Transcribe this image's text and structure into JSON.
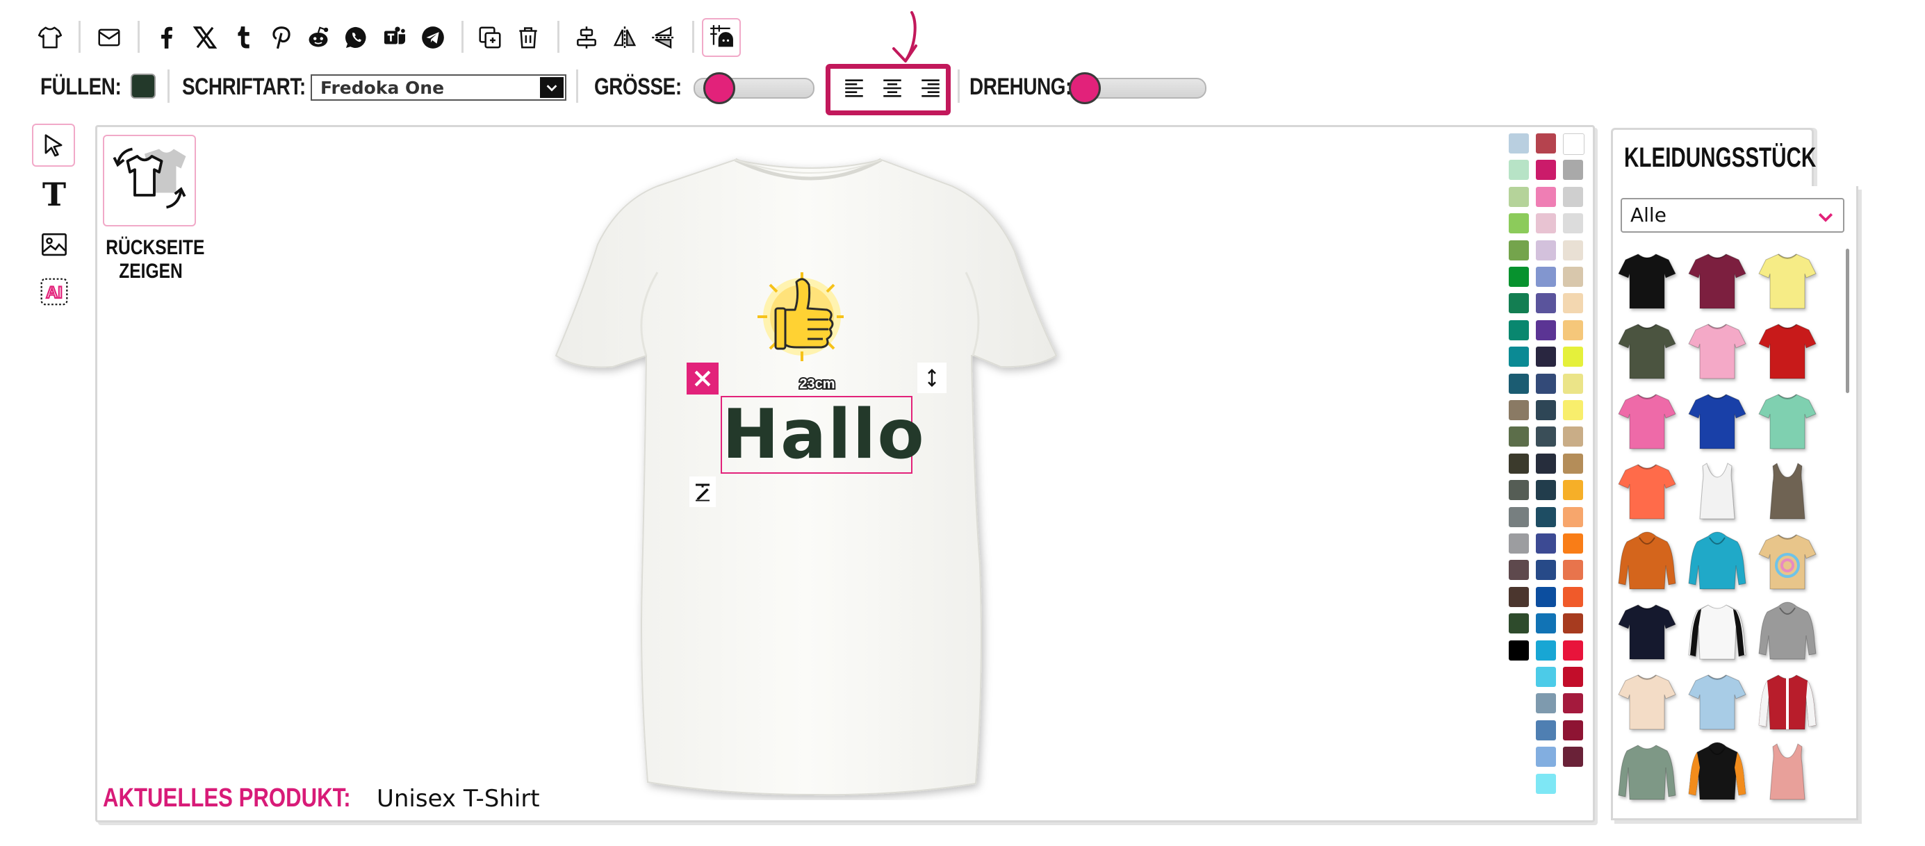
{
  "toolbar": {
    "fill_label": "FÜLLEN:",
    "fill_color": "#23392a",
    "font_label": "SCHRIFTART:",
    "font_value": "Fredoka One",
    "size_label": "GRÖSSE:",
    "size_level": 0.1,
    "rotation_label": "DREHUNG:",
    "rotation_level": 0.0,
    "top_icons": [
      "shirt-icon",
      "mail-icon",
      "facebook-icon",
      "x-icon",
      "tumblr-icon",
      "pinterest-icon",
      "reddit-icon",
      "whatsapp-icon",
      "teams-icon",
      "telegram-icon",
      "duplicate-icon",
      "trash-icon",
      "align-center-vertical-icon",
      "flip-horizontal-icon",
      "flip-vertical-icon",
      "grid-snap-icon"
    ],
    "align_icons": [
      "align-left-icon",
      "align-center-icon",
      "align-right-icon"
    ]
  },
  "left_tools": [
    "select-cursor-icon",
    "text-tool-icon",
    "image-tool-icon",
    "ai-tool-icon"
  ],
  "canvas": {
    "show_back_label_line1": "RÜCKSEITE",
    "show_back_label_line2": "ZEIGEN",
    "text_object": "Hallo",
    "text_color": "#23392a",
    "width_label": "23cm",
    "current_product_label": "AKTUELLES PRODUKT:",
    "current_product_name": "Unisex T-Shirt",
    "accent": "#d81b78"
  },
  "palette": {
    "col1": [
      "#b9cfe0",
      "#b7e3c6",
      "#b5d39a",
      "#8ccb5b",
      "#74a44c",
      "#07922e",
      "#137e52",
      "#09876f",
      "#0b8a94",
      "#1b5c72",
      "#8a7a64",
      "#5c6e4a",
      "#3b3a2c",
      "#555d55",
      "#777f80",
      "#9c9da0",
      "#5e494d",
      "#4b362e",
      "#2e4b2c",
      "#000000"
    ],
    "col2": [
      "#b5434e",
      "#cb1b6a",
      "#ef7eb4",
      "#e8c3d2",
      "#d3c1dc",
      "#8296cf",
      "#5a549c",
      "#5b3494",
      "#292640",
      "#334a78",
      "#2e4656",
      "#3a4e58",
      "#262d3c",
      "#223d4c",
      "#1e4d63",
      "#3c4a93",
      "#274a88",
      "#0c4e9f",
      "#1173b5",
      "#18a6d4",
      "#4ccbe8",
      "#7e9aae",
      "#4f7fb2",
      "#82aee0",
      "#7ee7f5"
    ],
    "col3": [
      "#ffffff",
      "#a9a9a9",
      "#cfcfcf",
      "#dcdcdc",
      "#e9e0d4",
      "#d8c7ac",
      "#f3d7b0",
      "#f5c77a",
      "#e5f03b",
      "#ebe488",
      "#f8ee6c",
      "#c9ad87",
      "#b48d59",
      "#f6af28",
      "#f7a66c",
      "#f97d17",
      "#e8744c",
      "#f05a2a",
      "#a73b1f",
      "#e8143b",
      "#c20d2a",
      "#a41a3d",
      "#8e1433",
      "#6a2238"
    ]
  },
  "side_panel": {
    "tab_label": "KLEIDUNGSSTÜCK",
    "filter_value": "Alle",
    "garments": [
      {
        "name": "tshirt-black",
        "color": "#121212"
      },
      {
        "name": "tshirt-maroon",
        "color": "#7c1f3f"
      },
      {
        "name": "tshirt-yellow",
        "color": "#f6ec86"
      },
      {
        "name": "tshirt-olive",
        "color": "#4b5440"
      },
      {
        "name": "tshirt-pink",
        "color": "#f4a9c7"
      },
      {
        "name": "tshirt-red",
        "color": "#c81a1a"
      },
      {
        "name": "tshirt-fuchsia",
        "color": "#ee6aa8"
      },
      {
        "name": "tshirt-royal",
        "color": "#1940a8"
      },
      {
        "name": "tshirt-mint",
        "color": "#7fd0b0"
      },
      {
        "name": "tshirt-coral",
        "color": "#ff6b4a"
      },
      {
        "name": "tank-white",
        "color": "#f2f2f2"
      },
      {
        "name": "tank-brown",
        "color": "#6f6353"
      },
      {
        "name": "hoodie-orange",
        "color": "#d4651c"
      },
      {
        "name": "hoodie-turquoise",
        "color": "#20a9c8"
      },
      {
        "name": "tshirt-tiedye",
        "color": "#e8c58a"
      },
      {
        "name": "tshirt-navy",
        "color": "#15192e"
      },
      {
        "name": "raglan-white-black",
        "color": "#f7f7f7"
      },
      {
        "name": "hoodie-grey",
        "color": "#9a9a9a"
      },
      {
        "name": "tshirt-cream",
        "color": "#f3dcc6"
      },
      {
        "name": "tshirt-skyfade",
        "color": "#a8cce6"
      },
      {
        "name": "jacket-red",
        "color": "#b81d2b"
      },
      {
        "name": "longsleeve-sage",
        "color": "#7e9886"
      },
      {
        "name": "hoodie-black-orange",
        "color": "#141414"
      },
      {
        "name": "tank-salmon",
        "color": "#e8a09a"
      }
    ]
  }
}
